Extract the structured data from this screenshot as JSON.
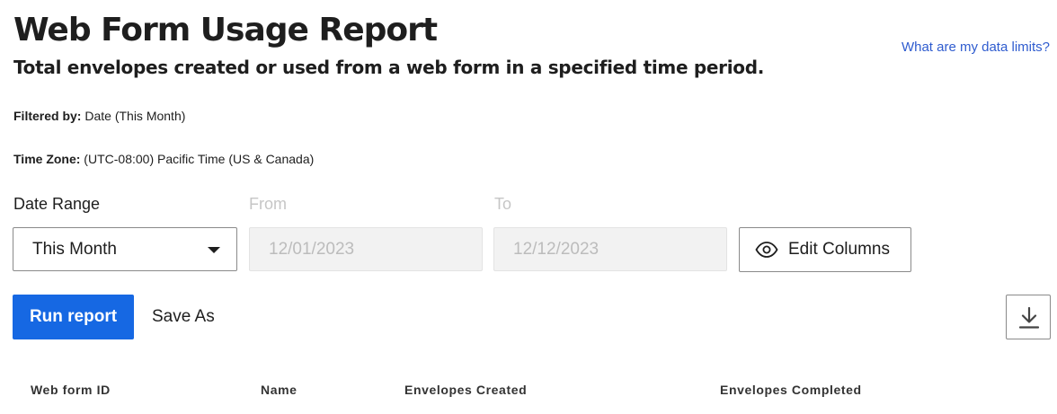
{
  "header": {
    "title": "Web Form Usage Report",
    "subtitle": "Total envelopes created or used from a web form in a specified time period.",
    "data_limits_link": "What are my data limits?"
  },
  "filters": {
    "filtered_by_label": "Filtered by:",
    "filtered_by_value": " Date (This Month)",
    "time_zone_label": "Time Zone:",
    "time_zone_value": " (UTC-08:00) Pacific Time (US & Canada)"
  },
  "controls": {
    "date_range_label": "Date Range",
    "date_range_value": "This Month",
    "from_label": "From",
    "from_value": "12/01/2023",
    "to_label": "To",
    "to_value": "12/12/2023",
    "edit_columns_label": "Edit Columns",
    "run_report_label": "Run report",
    "save_as_label": "Save As"
  },
  "table": {
    "columns": [
      "Web form ID",
      "Name",
      "Envelopes Created",
      "Envelopes Completed"
    ]
  },
  "icons": {
    "dropdown": "caret-down-icon",
    "edit_columns": "eye-icon",
    "download": "download-icon"
  },
  "colors": {
    "primary": "#1668e3",
    "link": "#2f5ccf",
    "text": "#1e1e1e",
    "disabled_text": "#bcbcbc",
    "disabled_bg": "#f2f2f2"
  }
}
